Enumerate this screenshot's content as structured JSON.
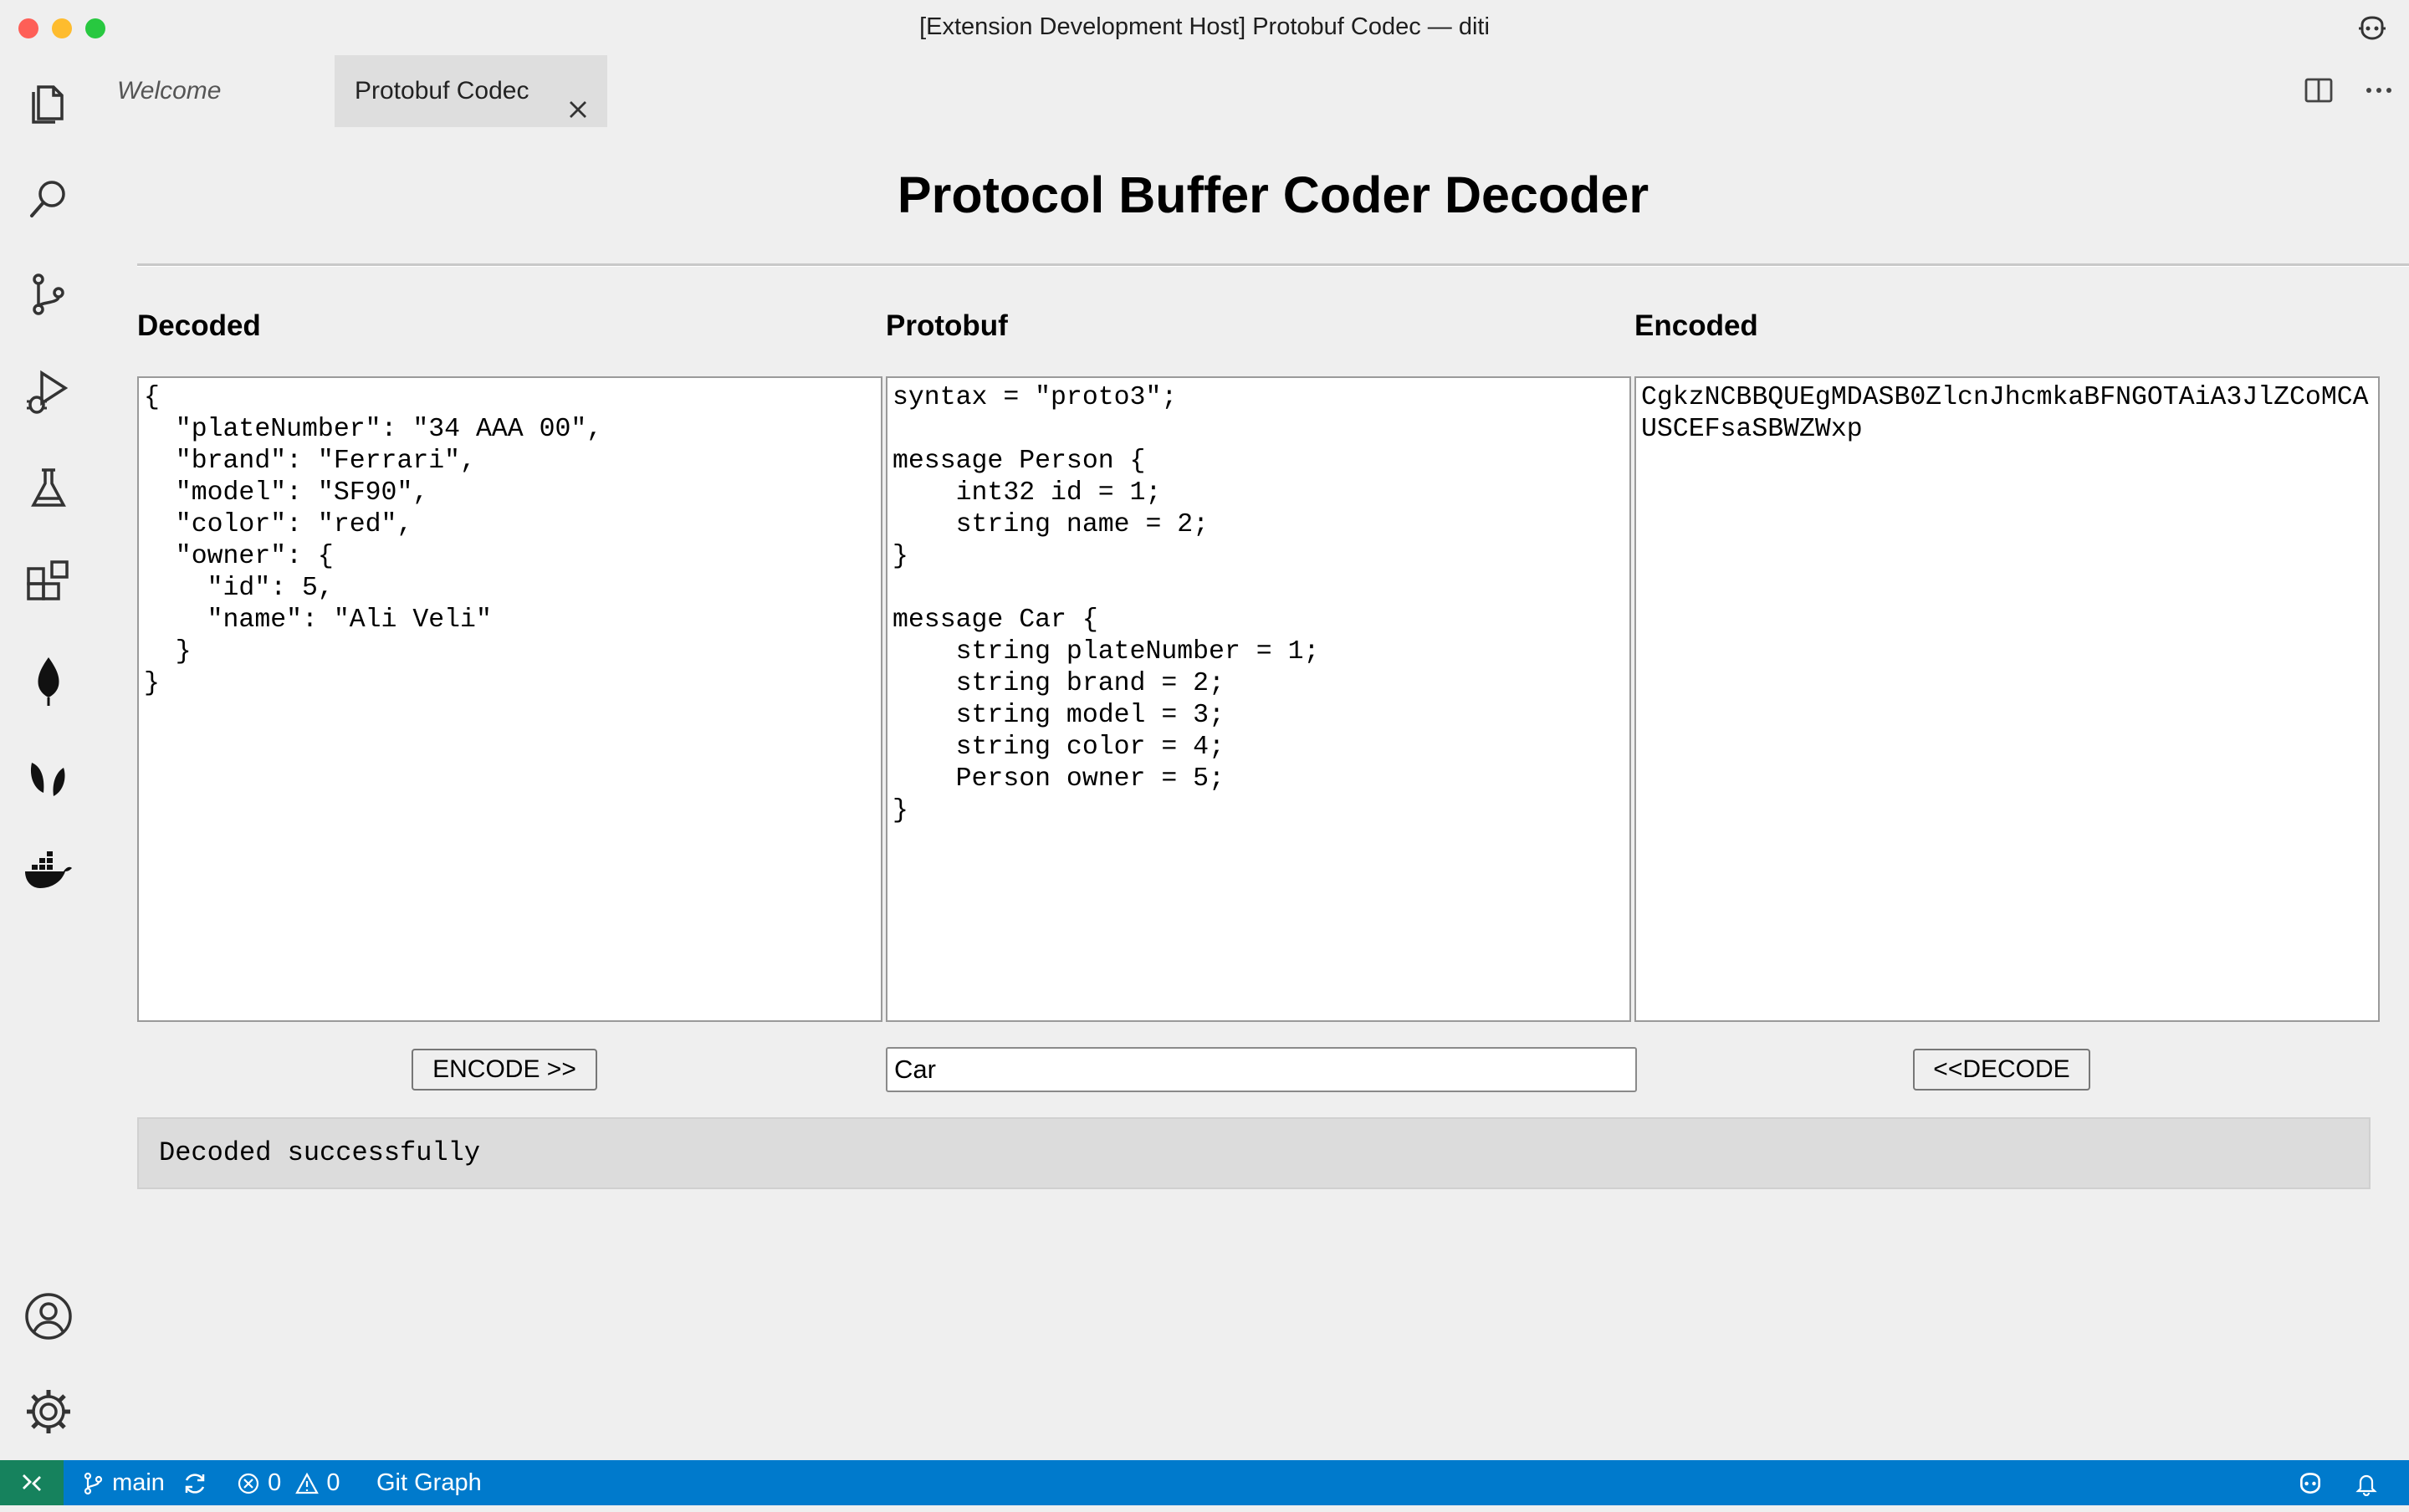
{
  "window": {
    "title": "[Extension Development Host] Protobuf Codec — diti"
  },
  "activity_bar": {
    "items": [
      "files-icon",
      "search-icon",
      "source-control-icon",
      "run-debug-icon",
      "testing-icon",
      "extensions-icon",
      "mongodb-leaf-icon",
      "leaves-icon",
      "docker-icon"
    ],
    "bottom": [
      "account-icon",
      "settings-gear-icon"
    ]
  },
  "tabs": [
    {
      "label": "Welcome",
      "active": false
    },
    {
      "label": "Protobuf Codec",
      "active": true
    }
  ],
  "page": {
    "title": "Protocol Buffer Coder Decoder",
    "decoded_label": "Decoded",
    "protobuf_label": "Protobuf",
    "encoded_label": "Encoded",
    "decoded_text": "{\n  \"plateNumber\": \"34 AAA 00\",\n  \"brand\": \"Ferrari\",\n  \"model\": \"SF90\",\n  \"color\": \"red\",\n  \"owner\": {\n    \"id\": 5,\n    \"name\": \"Ali Veli\"\n  }\n}",
    "protobuf_text": "syntax = \"proto3\";\n\nmessage Person {\n    int32 id = 1;\n    string name = 2;\n}\n\nmessage Car {\n    string plateNumber = 1;\n    string brand = 2;\n    string model = 3;\n    string color = 4;\n    Person owner = 5;\n}",
    "encoded_text": "CgkzNCBBQUEgMDASB0ZlcnJhcmkaBFNGOTAiA3JlZCoMCAUSCEFsaSBWZWxp",
    "encode_button": "ENCODE >>",
    "message_type": "Car",
    "decode_button": "<<DECODE",
    "status_message": "Decoded successfully"
  },
  "statusbar": {
    "branch": "main",
    "errors": "0",
    "warnings": "0",
    "git_graph": "Git Graph"
  },
  "colors": {
    "statusbar_bg": "#007acc",
    "remote_bg": "#16825d",
    "window_bg": "#efefef"
  }
}
